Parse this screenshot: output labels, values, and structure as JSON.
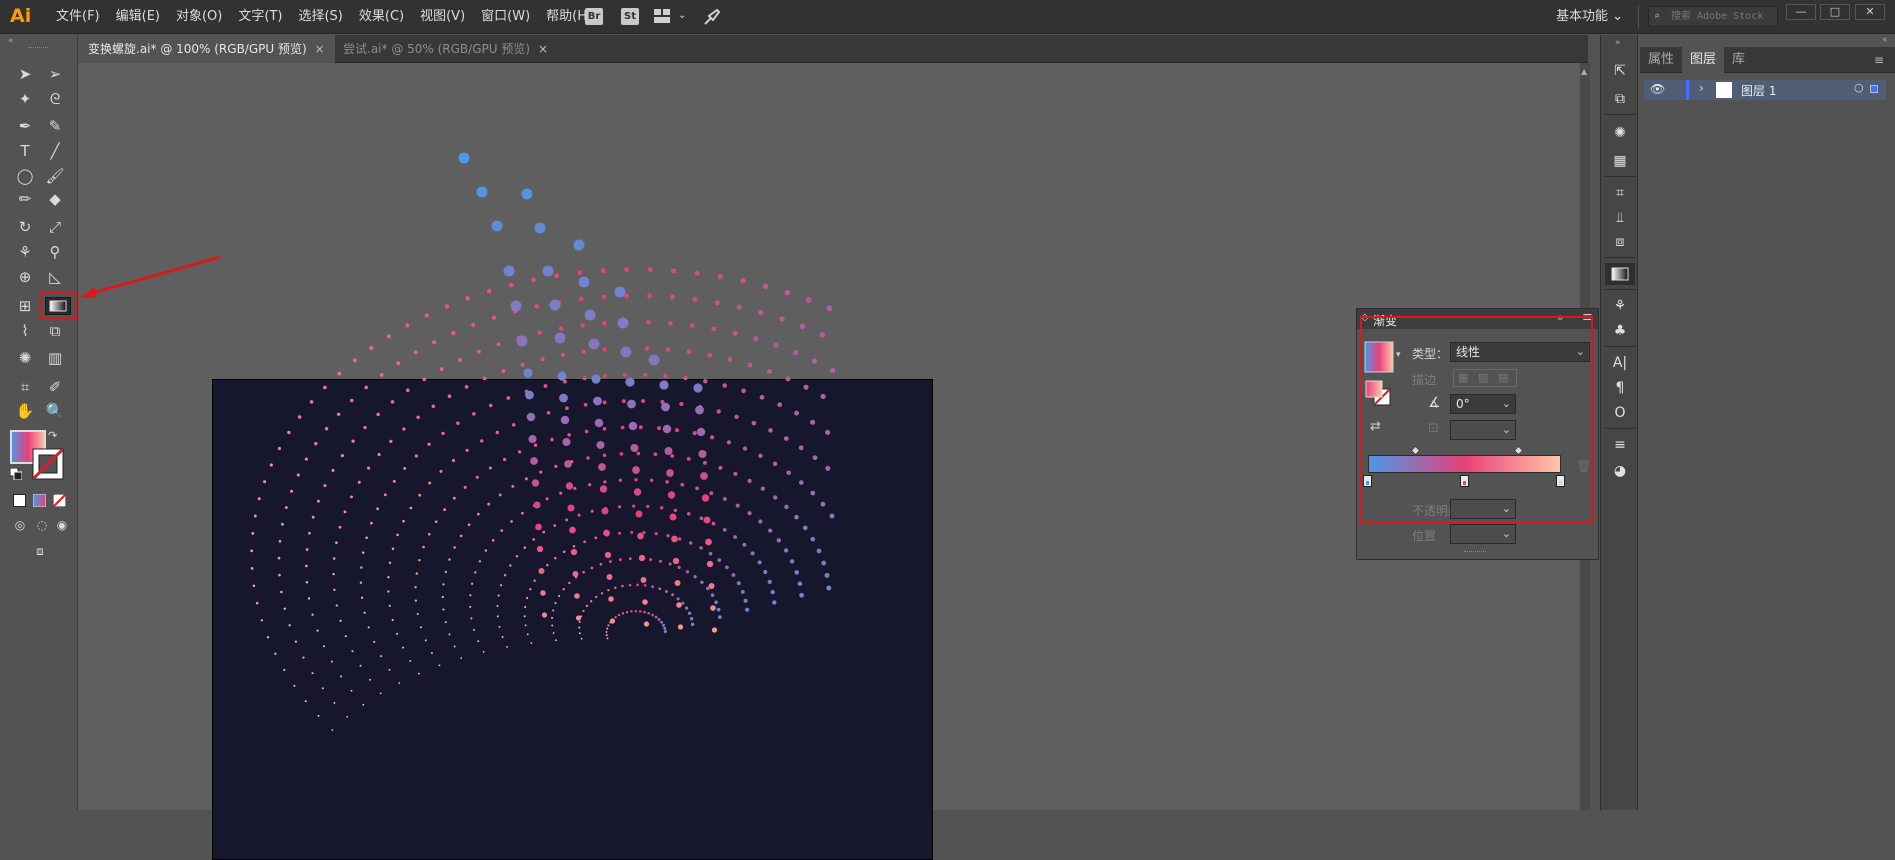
{
  "app": {
    "logo": "Ai"
  },
  "menu": [
    "文件(F)",
    "编辑(E)",
    "对象(O)",
    "文字(T)",
    "选择(S)",
    "效果(C)",
    "视图(V)",
    "窗口(W)",
    "帮助(H)"
  ],
  "menubar_icons": {
    "bridge": "Br",
    "stock": "St",
    "arrange": "arrange-documents-icon",
    "gpu": "rocket-icon"
  },
  "workspace": {
    "label": "基本功能",
    "icon": "chevron-down-icon"
  },
  "search": {
    "placeholder": "搜索 Adobe Stock"
  },
  "window_controls": {
    "minimize": "—",
    "maximize": "□",
    "close": "✕"
  },
  "tabs": [
    {
      "label": "变换螺旋.ai* @ 100% (RGB/GPU 预览)",
      "close": "×",
      "active": true
    },
    {
      "label": "尝试.ai* @ 50% (RGB/GPU 预览)",
      "close": "×",
      "active": false
    }
  ],
  "gradient_panel": {
    "title": "渐变",
    "type_label": "类型：",
    "type_value": "线性",
    "stroke_label": "描边",
    "angle_value": "0°",
    "opacity_label": "不透明度",
    "position_label": "位置",
    "collapse": "»",
    "menu_icon": "≡",
    "stops": [
      {
        "color": "#4a98e8",
        "position": 0
      },
      {
        "color": "#e8407a",
        "position": 0.5
      },
      {
        "color": "#ffc6a8",
        "position": 1
      }
    ],
    "midpoints": [
      0.25,
      0.78
    ]
  },
  "layers_panel": {
    "tabs": [
      {
        "label": "属性",
        "active": false
      },
      {
        "label": "图层",
        "active": true
      },
      {
        "label": "库",
        "active": false
      }
    ],
    "layers": [
      {
        "name": "图层 1"
      }
    ]
  },
  "colors": {
    "artboard": "#16162c",
    "gradient_start": "#4a98e8",
    "gradient_mid": "#e8407a",
    "gradient_end": "#ffc6a8",
    "highlight": "#d81a1a"
  }
}
